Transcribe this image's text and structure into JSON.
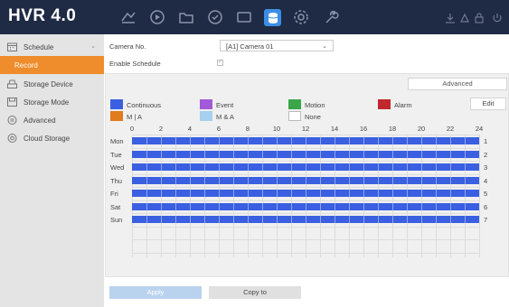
{
  "app": {
    "title": "HVR 4.0"
  },
  "topbar": {
    "icons": [
      "live-view-icon",
      "playback-icon",
      "file-management-icon",
      "smart-analysis-icon",
      "display-icon",
      "storage-icon",
      "settings-icon",
      "maintenance-icon",
      "download-icon",
      "alarm-icon",
      "lock-icon",
      "power-icon"
    ],
    "active": "storage-icon",
    "accent": "#3a8ee6"
  },
  "sidebar": {
    "items": [
      {
        "label": "Schedule",
        "icon": "calendar-icon",
        "expanded": true
      },
      {
        "label": "Record",
        "selected": true
      },
      {
        "label": "Storage Device",
        "icon": "storage-device-icon"
      },
      {
        "label": "Storage Mode",
        "icon": "storage-mode-icon"
      },
      {
        "label": "Advanced",
        "icon": "advanced-icon"
      },
      {
        "label": "Cloud Storage",
        "icon": "cloud-storage-icon"
      }
    ],
    "selected_color": "#ef8c2b"
  },
  "form": {
    "camera_label": "Camera No.",
    "camera_value": "[A1] Camera 01",
    "enable_label": "Enable Schedule",
    "enable_checked": true
  },
  "schedule": {
    "advanced_label": "Advanced",
    "edit_label": "Edit",
    "legend": [
      {
        "label": "Continuous",
        "color": "#3a5fe0"
      },
      {
        "label": "Event",
        "color": "#a35ad8"
      },
      {
        "label": "Motion",
        "color": "#3aa64a"
      },
      {
        "label": "Alarm",
        "color": "#c0282d"
      },
      {
        "label": "M | A",
        "color": "#e07b1e"
      },
      {
        "label": "M & A",
        "color": "#a6d0ee"
      },
      {
        "label": "None",
        "color": "#ffffff"
      }
    ],
    "hours": [
      "0",
      "2",
      "4",
      "6",
      "8",
      "10",
      "12",
      "14",
      "16",
      "18",
      "20",
      "22",
      "24"
    ],
    "days": [
      "Mon",
      "Tue",
      "Wed",
      "Thu",
      "Fri",
      "Sat",
      "Sun"
    ],
    "row_numbers": [
      "1",
      "2",
      "3",
      "4",
      "5",
      "6",
      "7"
    ],
    "fill_mode": "Continuous"
  },
  "actions": {
    "apply_label": "Apply",
    "copy_label": "Copy to"
  }
}
